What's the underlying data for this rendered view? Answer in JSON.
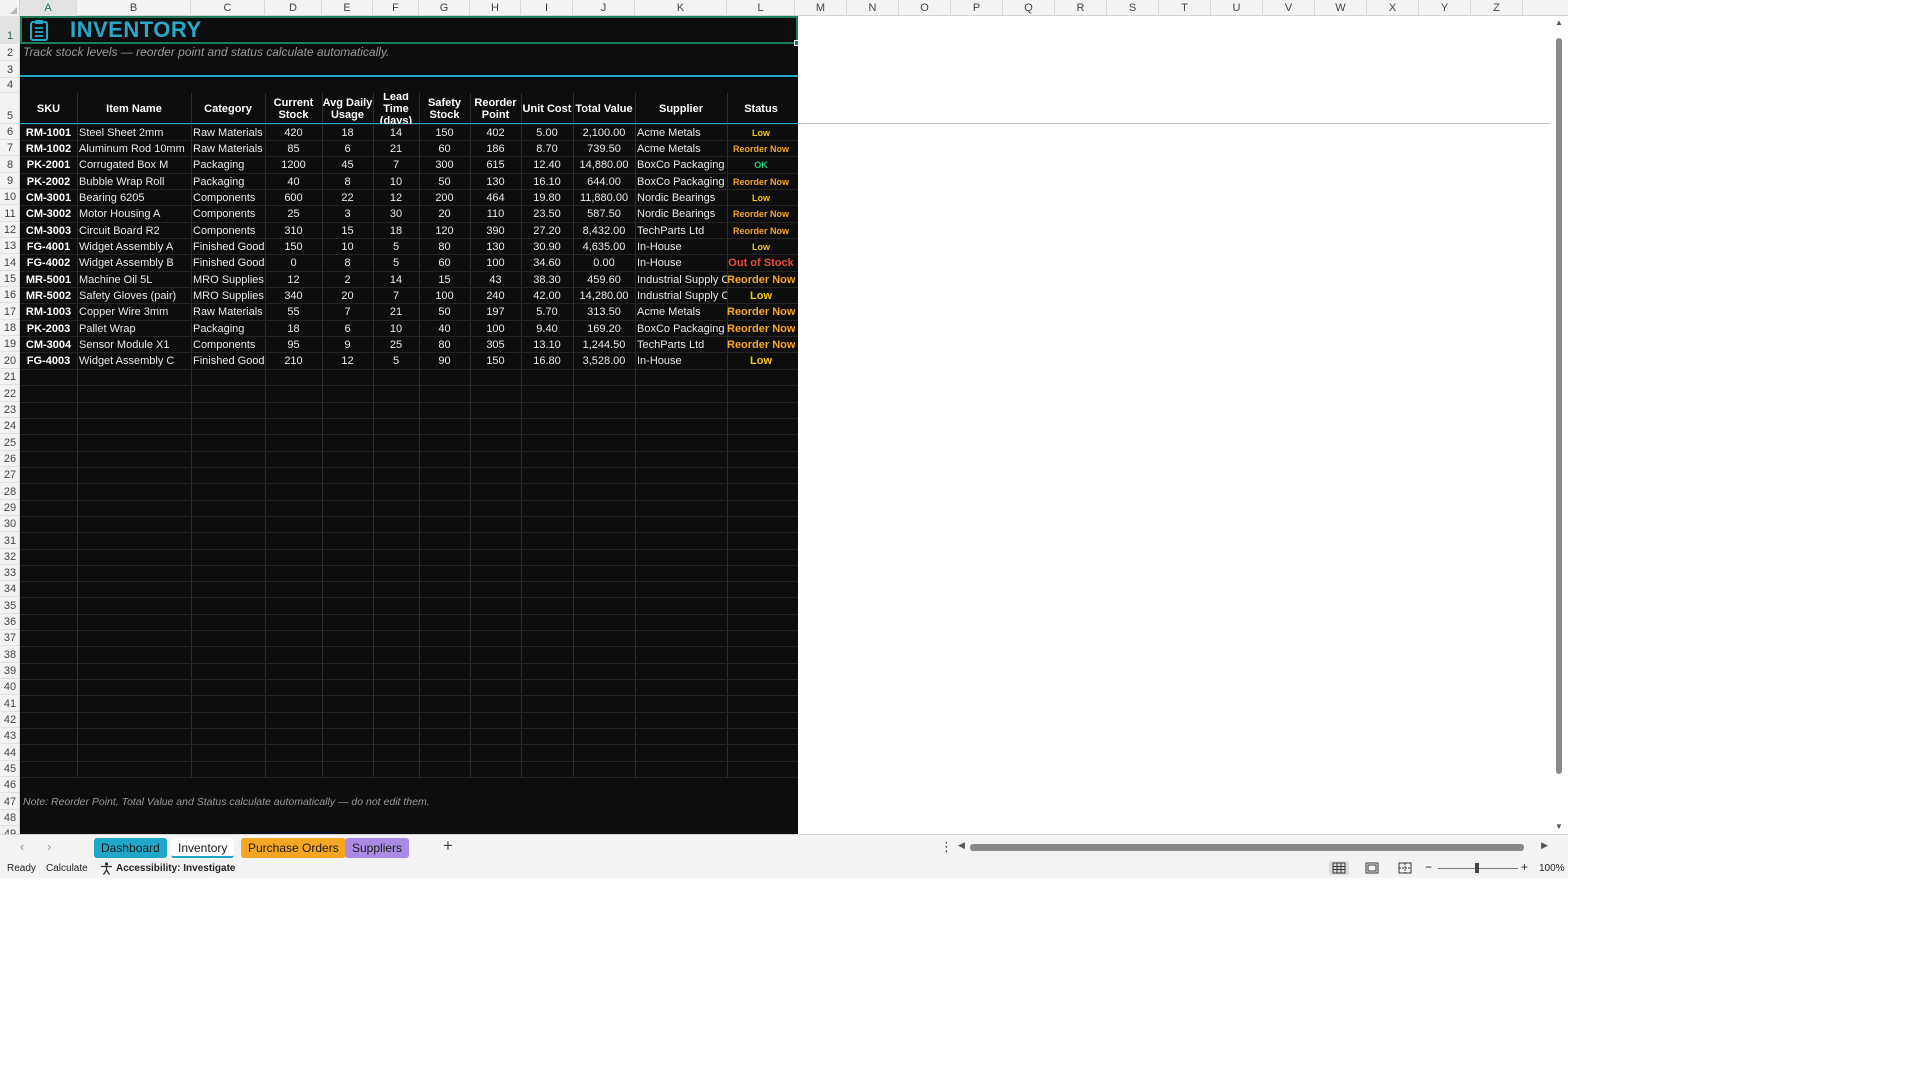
{
  "sheet": {
    "title": "INVENTORY",
    "subtitle": "Track stock levels — reorder point and status calculate automatically.",
    "headers": [
      "SKU",
      "Item Name",
      "Category",
      "Current Stock",
      "Avg Daily Usage",
      "Lead Time (days)",
      "Safety Stock",
      "Reorder Point",
      "Unit Cost",
      "Total Value",
      "Supplier",
      "Status"
    ],
    "rows": [
      {
        "sku": "RM-1001",
        "name": "Steel Sheet 2mm",
        "category": "Raw Materials",
        "stock": "420",
        "usage": "18",
        "lead": "14",
        "safety": "150",
        "reorder": "402",
        "cost": "5.00",
        "value": "2,100.00",
        "supplier": "Acme Metals",
        "status": "Low"
      },
      {
        "sku": "RM-1002",
        "name": "Aluminum Rod 10mm",
        "category": "Raw Materials",
        "stock": "85",
        "usage": "6",
        "lead": "21",
        "safety": "60",
        "reorder": "186",
        "cost": "8.70",
        "value": "739.50",
        "supplier": "Acme Metals",
        "status": "Reorder Now"
      },
      {
        "sku": "PK-2001",
        "name": "Corrugated Box M",
        "category": "Packaging",
        "stock": "1200",
        "usage": "45",
        "lead": "7",
        "safety": "300",
        "reorder": "615",
        "cost": "12.40",
        "value": "14,880.00",
        "supplier": "BoxCo Packaging",
        "status": "OK"
      },
      {
        "sku": "PK-2002",
        "name": "Bubble Wrap Roll",
        "category": "Packaging",
        "stock": "40",
        "usage": "8",
        "lead": "10",
        "safety": "50",
        "reorder": "130",
        "cost": "16.10",
        "value": "644.00",
        "supplier": "BoxCo Packaging",
        "status": "Reorder Now"
      },
      {
        "sku": "CM-3001",
        "name": "Bearing 6205",
        "category": "Components",
        "stock": "600",
        "usage": "22",
        "lead": "12",
        "safety": "200",
        "reorder": "464",
        "cost": "19.80",
        "value": "11,880.00",
        "supplier": "Nordic Bearings",
        "status": "Low"
      },
      {
        "sku": "CM-3002",
        "name": "Motor Housing A",
        "category": "Components",
        "stock": "25",
        "usage": "3",
        "lead": "30",
        "safety": "20",
        "reorder": "110",
        "cost": "23.50",
        "value": "587.50",
        "supplier": "Nordic Bearings",
        "status": "Reorder Now"
      },
      {
        "sku": "CM-3003",
        "name": "Circuit Board R2",
        "category": "Components",
        "stock": "310",
        "usage": "15",
        "lead": "18",
        "safety": "120",
        "reorder": "390",
        "cost": "27.20",
        "value": "8,432.00",
        "supplier": "TechParts Ltd",
        "status": "Reorder Now"
      },
      {
        "sku": "FG-4001",
        "name": "Widget Assembly A",
        "category": "Finished Goods",
        "stock": "150",
        "usage": "10",
        "lead": "5",
        "safety": "80",
        "reorder": "130",
        "cost": "30.90",
        "value": "4,635.00",
        "supplier": "In-House",
        "status": "Low"
      },
      {
        "sku": "FG-4002",
        "name": "Widget Assembly B",
        "category": "Finished Goods",
        "stock": "0",
        "usage": "8",
        "lead": "5",
        "safety": "60",
        "reorder": "100",
        "cost": "34.60",
        "value": "0.00",
        "supplier": "In-House",
        "status": "Out of Stock"
      },
      {
        "sku": "MR-5001",
        "name": "Machine Oil 5L",
        "category": "MRO Supplies",
        "stock": "12",
        "usage": "2",
        "lead": "14",
        "safety": "15",
        "reorder": "43",
        "cost": "38.30",
        "value": "459.60",
        "supplier": "Industrial Supply Co",
        "status": "Reorder Now"
      },
      {
        "sku": "MR-5002",
        "name": "Safety Gloves (pair)",
        "category": "MRO Supplies",
        "stock": "340",
        "usage": "20",
        "lead": "7",
        "safety": "100",
        "reorder": "240",
        "cost": "42.00",
        "value": "14,280.00",
        "supplier": "Industrial Supply Co",
        "status": "Low"
      },
      {
        "sku": "RM-1003",
        "name": "Copper Wire 3mm",
        "category": "Raw Materials",
        "stock": "55",
        "usage": "7",
        "lead": "21",
        "safety": "50",
        "reorder": "197",
        "cost": "5.70",
        "value": "313.50",
        "supplier": "Acme Metals",
        "status": "Reorder Now"
      },
      {
        "sku": "PK-2003",
        "name": "Pallet Wrap",
        "category": "Packaging",
        "stock": "18",
        "usage": "6",
        "lead": "10",
        "safety": "40",
        "reorder": "100",
        "cost": "9.40",
        "value": "169.20",
        "supplier": "BoxCo Packaging",
        "status": "Reorder Now"
      },
      {
        "sku": "CM-3004",
        "name": "Sensor Module X1",
        "category": "Components",
        "stock": "95",
        "usage": "9",
        "lead": "25",
        "safety": "80",
        "reorder": "305",
        "cost": "13.10",
        "value": "1,244.50",
        "supplier": "TechParts Ltd",
        "status": "Reorder Now"
      },
      {
        "sku": "FG-4003",
        "name": "Widget Assembly C",
        "category": "Finished Goods",
        "stock": "210",
        "usage": "12",
        "lead": "5",
        "safety": "90",
        "reorder": "150",
        "cost": "16.80",
        "value": "3,528.00",
        "supplier": "In-House",
        "status": "Low"
      }
    ],
    "note": "Note: Reorder Point, Total Value and Status calculate automatically — do not edit them."
  },
  "columns": [
    "A",
    "B",
    "C",
    "D",
    "E",
    "F",
    "G",
    "H",
    "I",
    "J",
    "K",
    "L",
    "M",
    "N",
    "O",
    "P",
    "Q",
    "R",
    "S",
    "T",
    "U",
    "V",
    "W",
    "X",
    "Y",
    "Z"
  ],
  "row_numbers": [
    "1",
    "2",
    "3",
    "4",
    "5",
    "6",
    "7",
    "8",
    "9",
    "10",
    "11",
    "12",
    "13",
    "14",
    "15",
    "16",
    "17",
    "18",
    "19",
    "20",
    "21",
    "22",
    "23",
    "24",
    "25",
    "26",
    "27",
    "28",
    "29",
    "30",
    "31",
    "32",
    "33",
    "34",
    "35",
    "36",
    "37",
    "38",
    "39",
    "40",
    "41",
    "42",
    "43",
    "44",
    "45",
    "46",
    "47",
    "48",
    "49"
  ],
  "tabs": [
    {
      "label": "Dashboard",
      "color": "#1fa6c9",
      "active": false
    },
    {
      "label": "Inventory",
      "color": "#1fa6c9",
      "active": true
    },
    {
      "label": "Purchase Orders",
      "color": "#f5a623",
      "active": false
    },
    {
      "label": "Suppliers",
      "color": "#a98be6",
      "active": false
    }
  ],
  "status_bar": {
    "ready": "Ready",
    "calculate": "Calculate",
    "accessibility": "Accessibility: Investigate",
    "zoom": "100%"
  },
  "status_colors": {
    "OK": "#2ecc71",
    "Low": "#f5c518",
    "Reorder Now": "#f5a623",
    "Out of Stock": "#e74c3c"
  },
  "theme": {
    "accent": "#1fa6c9",
    "sheet_bg": "#0d0d0d",
    "selection": "#1e7e5a"
  }
}
